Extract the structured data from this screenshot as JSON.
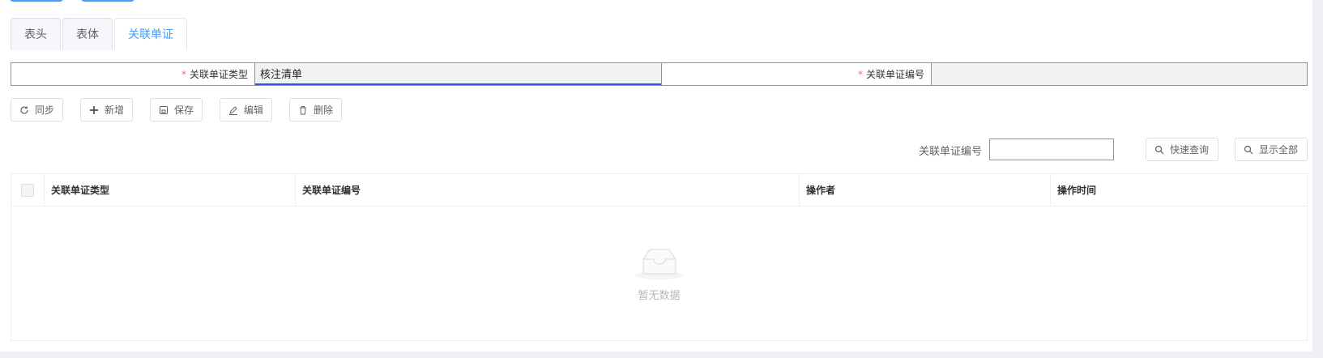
{
  "tabs": [
    {
      "label": "表头",
      "active": false
    },
    {
      "label": "表体",
      "active": false
    },
    {
      "label": "关联单证",
      "active": true
    }
  ],
  "form": {
    "type_label": "关联单证类型",
    "type_value": "核注清单",
    "number_label": "关联单证编号",
    "number_value": "",
    "required_mark": "*"
  },
  "toolbar": {
    "sync": "同步",
    "add": "新增",
    "save": "保存",
    "edit": "编辑",
    "delete": "删除"
  },
  "search": {
    "label": "关联单证编号",
    "value": "",
    "quick_query": "快速查询",
    "show_all": "显示全部"
  },
  "table": {
    "columns": [
      "关联单证类型",
      "关联单证编号",
      "操作者",
      "操作时间"
    ],
    "rows": [],
    "empty_text": "暂无数据"
  },
  "colors": {
    "accent": "#409eff",
    "required": "#f56c6c",
    "active_input_border": "#2f54eb"
  }
}
